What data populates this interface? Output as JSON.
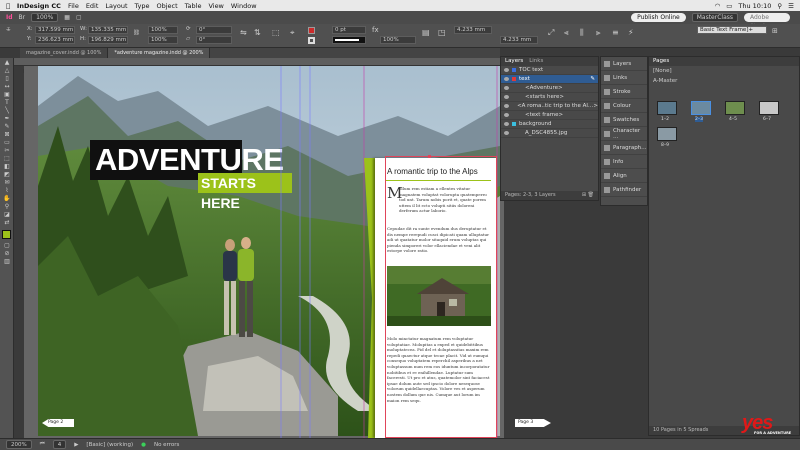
{
  "menubar": {
    "app_name": "InDesign CC",
    "menus": [
      "File",
      "Edit",
      "Layout",
      "Type",
      "Object",
      "Table",
      "View",
      "Window"
    ],
    "clock": "Thu 10:10"
  },
  "appbar": {
    "zoom": "100%",
    "publish_label": "Publish Online",
    "workspace": "MasterClass",
    "search_placeholder": "Adobe Stock"
  },
  "control_panel": {
    "x": "317.599 mm",
    "y": "236.623 mm",
    "w": "135.335 mm",
    "h": "196.829 mm",
    "scale_x": "100%",
    "scale_y": "100%",
    "rotate": "0°",
    "shear": "0°",
    "stroke_weight": "0 pt",
    "opacity": "100%",
    "gap": "4.233 mm",
    "gap2": "4.233 mm",
    "object_style": "Basic Text Frame]+",
    "fill_color": "#cc2a2a"
  },
  "doc_tabs": [
    {
      "label": "magazine_cover.indd @ 100%",
      "active": false
    },
    {
      "label": "*adventure magazine.indd @ 200%",
      "active": true
    }
  ],
  "artwork": {
    "headline": "ADVENTURE",
    "subhead": "STARTS HERE",
    "article_title": "A romantic trip to the Alps",
    "drop_cap": "M",
    "para1": "ollum rem estiam a ellentes vitatur magnatem voluptat volorupta quatemperro tod unt. Tarum nobis porit et, quate porem uttem il lit ecto volupti sitiis doloreni derferum actur laborio.",
    "para2": "Cepudae dit ra sunte evendum dus deruptatur et dis nempe rerepudi cusci dipicati quam ulluptatur adi ut quatatur molor sitaquid erum voluptas qui pienda simporeri volor ellaciendae et veni alit estorpe volore ratio.",
    "para3": "Molo minctatur magnatum rem voluptatur voluptatiae. Molupitas a exped et quidebittibus moluptatecea. Pid del et doluptassitas maxim rem repedi quaectur atque tecae placit. Vid ut eumqui consequo voluptatem reperchil asperibus a net voluptassum num rem eos iduntum incorporatatur nobitibus et re enihillendae. Luptatur sum faceresti. Ut pro et atus, quatemolor sint faciacest ipsae dolum aute sed ipscio dolore nesequose volorum quidellaecuptas. Volore ves et asperum nostem dollum que nis. Cumque aut lorum im maion rem sequ.",
    "page_left": "Page 2",
    "page_right": "Page 3",
    "green": "#9cc21a"
  },
  "layers_panel": {
    "tabs": [
      "Layers",
      "Links"
    ],
    "rows": [
      {
        "label": "TOC text",
        "color": "#3b6fe0",
        "selected": false
      },
      {
        "label": "text",
        "color": "#e03b3b",
        "selected": true
      },
      {
        "label": "<Adventure>",
        "color": "#e03b3b",
        "selected": false
      },
      {
        "label": "<starts here>",
        "color": "#e03b3b",
        "selected": false
      },
      {
        "label": "<A roma..tic trip to the Al…>",
        "color": "#e03b3b",
        "selected": false
      },
      {
        "label": "<text frame>",
        "color": "#e03b3b",
        "selected": false
      },
      {
        "label": "background",
        "color": "#3bc0e0",
        "selected": false
      },
      {
        "label": "A_DSC4855.jpg",
        "color": "#3bc0e0",
        "selected": false
      }
    ],
    "footer": "Pages: 2-3, 3 Layers"
  },
  "panel_strip": [
    {
      "label": "Layers",
      "icon": "layers-icon"
    },
    {
      "label": "Links",
      "icon": "links-icon"
    },
    {
      "label": "Stroke",
      "icon": "stroke-icon"
    },
    {
      "label": "Colour",
      "icon": "colour-icon"
    },
    {
      "label": "Swatches",
      "icon": "swatches-icon"
    },
    {
      "label": "Character …",
      "icon": "character-icon"
    },
    {
      "label": "Paragraph…",
      "icon": "paragraph-icon"
    },
    {
      "label": "Info",
      "icon": "info-icon"
    },
    {
      "label": "Align",
      "icon": "align-icon"
    },
    {
      "label": "Pathfinder",
      "icon": "pathfinder-icon"
    }
  ],
  "pages_panel": {
    "title": "Pages",
    "none_label": "[None]",
    "master_label": "A-Master",
    "page_labels": [
      "1–2",
      "2–3",
      "4–5",
      "6–7",
      "8–9"
    ],
    "footer": "10 Pages in 5 Spreads"
  },
  "status": {
    "zoom": "200%",
    "page": "4",
    "profile": "[Basic] (working)",
    "errors": "No errors"
  },
  "logo": {
    "word": "yes",
    "tagline": "FOR A ADVENTURE"
  }
}
